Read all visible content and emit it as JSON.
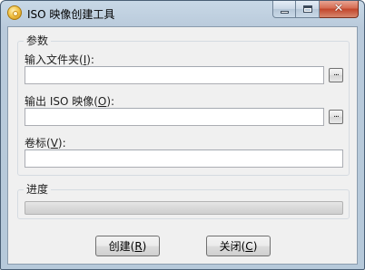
{
  "window": {
    "title": "ISO 映像创建工具",
    "caption_buttons": {
      "minimize": "minimize-icon",
      "maximize": "maximize-icon",
      "close": "close-icon"
    },
    "close_glyph": "✕"
  },
  "params": {
    "legend": "参数",
    "input_folder": {
      "label": "输入文件夹(",
      "mnemonic": "I",
      "suffix": "):",
      "value": "",
      "browse": "..."
    },
    "output_iso": {
      "label": "输出 ISO 映像(",
      "mnemonic": "O",
      "suffix": "):",
      "value": "",
      "browse": "..."
    },
    "volume": {
      "label": "卷标(",
      "mnemonic": "V",
      "suffix": "):",
      "value": ""
    }
  },
  "progress": {
    "legend": "进度",
    "value": 0
  },
  "buttons": {
    "create": {
      "label": "创建(",
      "mnemonic": "R",
      "suffix": ")"
    },
    "close": {
      "label": "关闭(",
      "mnemonic": "C",
      "suffix": ")"
    }
  },
  "colors": {
    "progress_fill": "#06b025",
    "close_button": "#c2462b"
  }
}
